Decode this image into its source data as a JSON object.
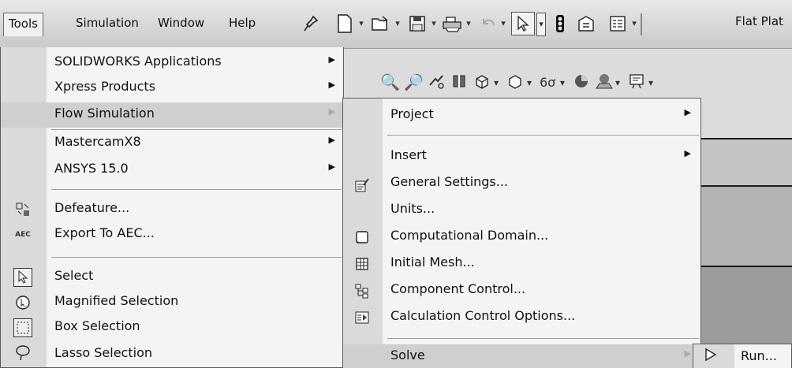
{
  "menubar": {
    "items": [
      "Tools",
      "Simulation",
      "Window",
      "Help"
    ],
    "document_title": "Flat Plat"
  },
  "toolbar_icons": [
    "pin-icon",
    "new-document-icon",
    "open-icon",
    "save-icon",
    "print-icon",
    "undo-icon",
    "select-arrow-icon",
    "traffic-light-icon",
    "options-icon",
    "customize-icon"
  ],
  "view_icons": [
    "zoom-fit-icon",
    "zoom-area-icon",
    "previous-view-icon",
    "section-view-icon",
    "view-orientation-icon",
    "display-style-icon",
    "hide-show-icon",
    "appearance-icon",
    "scene-icon",
    "view-settings-icon"
  ],
  "tools_menu": {
    "items": [
      {
        "label": "SOLIDWORKS Applications",
        "has_submenu": true
      },
      {
        "label": "Xpress Products",
        "has_submenu": true
      },
      {
        "label": "Flow Simulation",
        "has_submenu": true,
        "highlighted": true
      },
      {
        "label": "MastercamX8",
        "has_submenu": true
      },
      {
        "label": "ANSYS 15.0",
        "has_submenu": true
      },
      {
        "label": "Defeature...",
        "icon": "defeature-icon"
      },
      {
        "label": "Export To AEC...",
        "icon": "export-aec-icon"
      },
      {
        "label": "Select",
        "icon": "select-icon"
      },
      {
        "label": "Magnified Selection",
        "icon": "magnified-selection-icon"
      },
      {
        "label": "Box Selection",
        "icon": "box-selection-icon"
      },
      {
        "label": "Lasso Selection",
        "icon": "lasso-selection-icon"
      }
    ]
  },
  "flow_submenu": {
    "items": [
      {
        "label": "Project",
        "has_submenu": true
      },
      {
        "label": "Insert",
        "has_submenu": true
      },
      {
        "label": "General Settings...",
        "icon": "general-settings-icon"
      },
      {
        "label": "Units..."
      },
      {
        "label": "Computational Domain...",
        "icon": "computational-domain-icon"
      },
      {
        "label": "Initial Mesh...",
        "icon": "initial-mesh-icon"
      },
      {
        "label": "Component Control...",
        "icon": "component-control-icon"
      },
      {
        "label": "Calculation Control Options...",
        "icon": "calculation-control-icon"
      },
      {
        "label": "Solve",
        "has_submenu": true,
        "highlighted": true
      }
    ]
  },
  "solve_submenu": {
    "items": [
      {
        "label": "Run...",
        "icon": "run-icon"
      }
    ]
  }
}
